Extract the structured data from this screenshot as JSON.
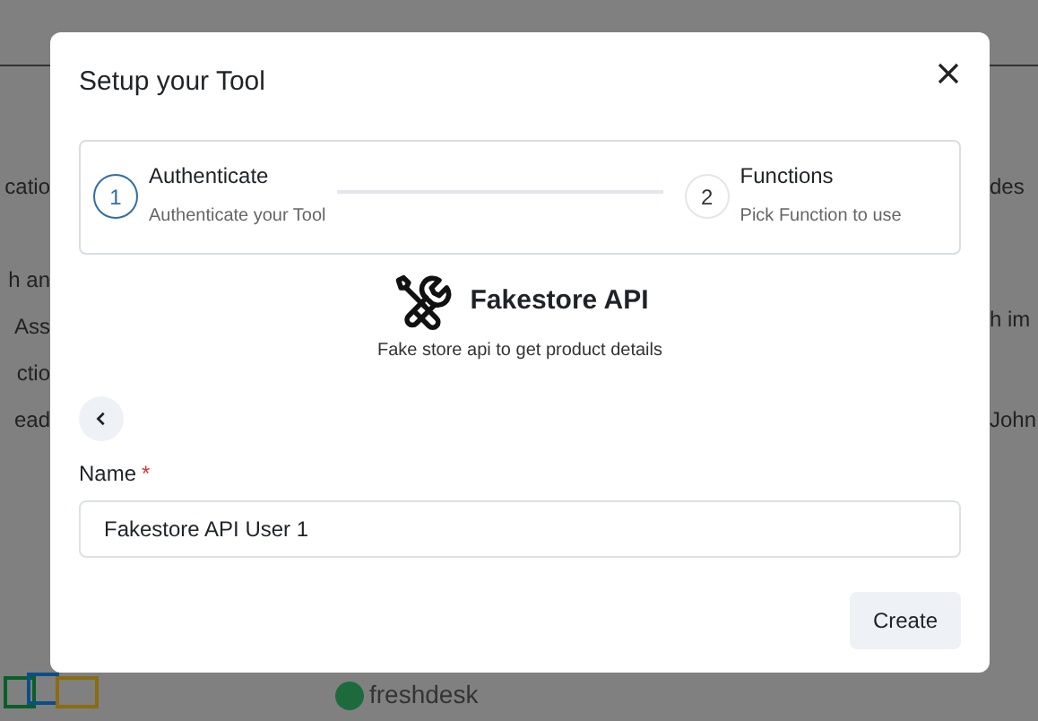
{
  "background": {
    "left_fragments": [
      "catio",
      "h an",
      "Ass",
      "ctio",
      "ead"
    ],
    "right_fragments": [
      "des",
      "h im",
      "John"
    ],
    "bottom_logo_text": "freshdesk"
  },
  "dialog": {
    "title": "Setup your Tool",
    "steps": [
      {
        "number": "1",
        "title": "Authenticate",
        "subtitle": "Authenticate your Tool",
        "selected": true
      },
      {
        "number": "2",
        "title": "Functions",
        "subtitle": "Pick Function to use",
        "selected": false
      }
    ],
    "tool": {
      "name": "Fakestore API",
      "description": "Fake store api to get product details"
    },
    "field": {
      "label": "Name",
      "required_mark": "*",
      "value": "Fakestore API User 1"
    },
    "button": "Create"
  }
}
